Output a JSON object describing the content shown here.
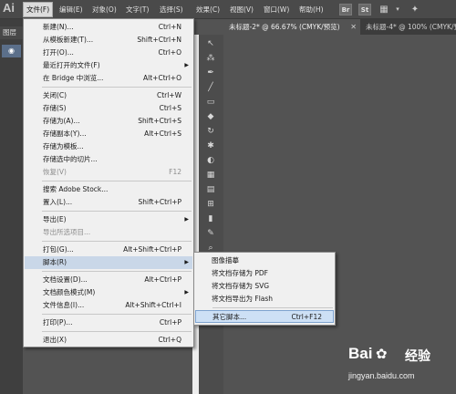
{
  "app": {
    "logo": "Ai"
  },
  "menubar": {
    "items": [
      "文件(F)",
      "编辑(E)",
      "对象(O)",
      "文字(T)",
      "选择(S)",
      "效果(C)",
      "视图(V)",
      "窗口(W)",
      "帮助(H)"
    ],
    "icons": {
      "bridge": "Br",
      "stock": "St"
    }
  },
  "doc_tabs": [
    {
      "label": "未标题-2* @ 66.67% (CMYK/预览)"
    },
    {
      "label": "未标题-4* @ 100% (CMYK/预览)"
    }
  ],
  "layers_panel": {
    "title": "图层"
  },
  "file_menu": {
    "items": [
      {
        "label": "新建(N)...",
        "shortcut": "Ctrl+N"
      },
      {
        "label": "从模板新建(T)...",
        "shortcut": "Shift+Ctrl+N"
      },
      {
        "label": "打开(O)...",
        "shortcut": "Ctrl+O"
      },
      {
        "label": "最近打开的文件(F)",
        "shortcut": ""
      },
      {
        "label": "在 Bridge 中浏览...",
        "shortcut": "Alt+Ctrl+O"
      },
      {
        "label": "关闭(C)",
        "shortcut": "Ctrl+W"
      },
      {
        "label": "存储(S)",
        "shortcut": "Ctrl+S"
      },
      {
        "label": "存储为(A)...",
        "shortcut": "Shift+Ctrl+S"
      },
      {
        "label": "存储副本(Y)...",
        "shortcut": "Alt+Ctrl+S"
      },
      {
        "label": "存储为模板...",
        "shortcut": ""
      },
      {
        "label": "存储选中的切片...",
        "shortcut": ""
      },
      {
        "label": "恢复(V)",
        "shortcut": "F12"
      },
      {
        "label": "搜索 Adobe Stock...",
        "shortcut": ""
      },
      {
        "label": "置入(L)...",
        "shortcut": "Shift+Ctrl+P"
      },
      {
        "label": "导出(E)",
        "shortcut": ""
      },
      {
        "label": "导出所选项目...",
        "shortcut": ""
      },
      {
        "label": "打包(G)...",
        "shortcut": "Alt+Shift+Ctrl+P"
      },
      {
        "label": "脚本(R)",
        "shortcut": ""
      },
      {
        "label": "文档设置(D)...",
        "shortcut": "Alt+Ctrl+P"
      },
      {
        "label": "文档颜色模式(M)",
        "shortcut": ""
      },
      {
        "label": "文件信息(I)...",
        "shortcut": "Alt+Shift+Ctrl+I"
      },
      {
        "label": "打印(P)...",
        "shortcut": "Ctrl+P"
      },
      {
        "label": "退出(X)",
        "shortcut": "Ctrl+Q"
      }
    ]
  },
  "scripts_submenu": {
    "items": [
      {
        "label": "图像描摹",
        "shortcut": ""
      },
      {
        "label": "将文档存储为 PDF",
        "shortcut": ""
      },
      {
        "label": "将文档存储为 SVG",
        "shortcut": ""
      },
      {
        "label": "将文档导出为 Flash",
        "shortcut": ""
      },
      {
        "label": "其它脚本...",
        "shortcut": "Ctrl+F12"
      }
    ]
  },
  "watermark": {
    "brand": "Bai",
    "suffix": "经验",
    "url": "jingyan.baidu.com"
  }
}
